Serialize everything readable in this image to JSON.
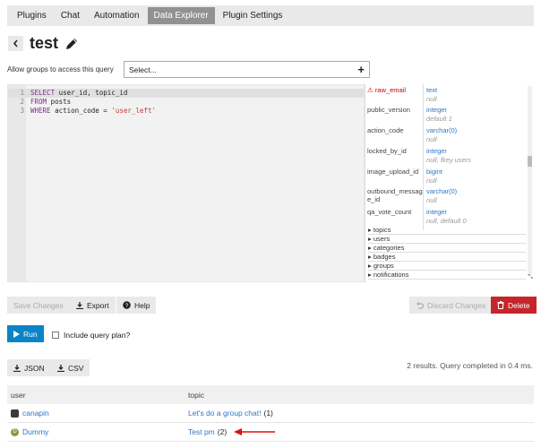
{
  "nav": {
    "tabs": [
      {
        "label": "Plugins"
      },
      {
        "label": "Chat"
      },
      {
        "label": "Automation"
      },
      {
        "label": "Data Explorer",
        "active": true
      },
      {
        "label": "Plugin Settings"
      }
    ]
  },
  "query": {
    "title": "test",
    "allow_groups_label": "Allow groups to access this query",
    "groups_select_placeholder": "Select...",
    "sql_lines": [
      {
        "num": "1",
        "kw": "SELECT",
        "rest": " user_id, topic_id"
      },
      {
        "num": "2",
        "kw": "FROM",
        "rest": " posts"
      },
      {
        "num": "3",
        "kw": "WHERE",
        "rest": " action_code = ",
        "str": "'user_left'"
      }
    ]
  },
  "schema": {
    "columns": [
      {
        "name": "raw_email",
        "type": "text",
        "note": "null",
        "warn": true
      },
      {
        "name": "public_version",
        "type": "integer",
        "note": "default 1"
      },
      {
        "name": "action_code",
        "type": "varchar(0)",
        "note": "null"
      },
      {
        "name": "locked_by_id",
        "type": "integer",
        "note": "null, fkey users"
      },
      {
        "name": "image_upload_id",
        "type": "bigint",
        "note": "null"
      },
      {
        "name": "outbound_message_id",
        "name_display": "outbound_messag\ne_id",
        "type": "varchar(0)",
        "note": "null"
      },
      {
        "name": "qa_vote_count",
        "type": "integer",
        "note": "null, default 0"
      }
    ],
    "tables": [
      "topics",
      "users",
      "categories",
      "badges",
      "groups",
      "notifications"
    ]
  },
  "actions": {
    "save": "Save Changes",
    "export": "Export",
    "help": "Help",
    "discard": "Discard Changes",
    "delete": "Delete",
    "run": "Run",
    "include_plan": "Include query plan?",
    "json": "JSON",
    "csv": "CSV"
  },
  "results": {
    "summary": "2 results. Query completed in 0.4 ms.",
    "headers": [
      "user",
      "topic"
    ],
    "rows": [
      {
        "user": "canapin",
        "topic": "Let's do a group chat!",
        "count": "(1)"
      },
      {
        "user": "Dummy",
        "avatar_letter": "D",
        "topic": "Test pm",
        "count": "(2)"
      }
    ]
  },
  "colors": {
    "accent_blue": "#0a84c6",
    "danger_red": "#c4262c",
    "link_blue": "#2b77c7"
  }
}
